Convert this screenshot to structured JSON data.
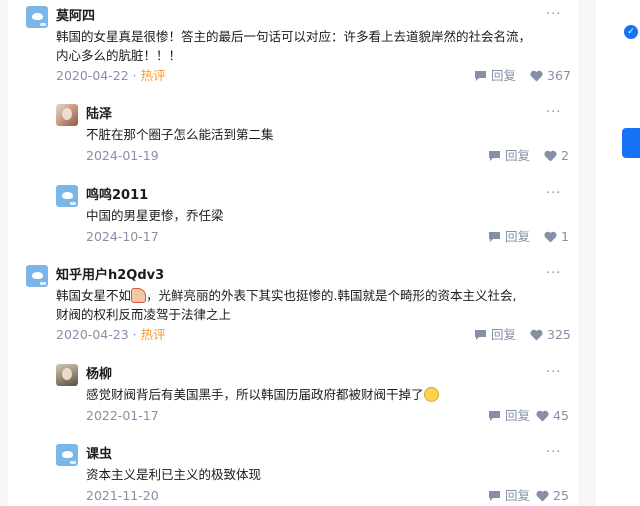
{
  "comments": [
    {
      "author": "莫阿四",
      "content_line1": "韩国的女星真是很惨！答主的最后一句话可以对应：许多看上去道貌岸然的社会名流，",
      "content_line2": "内心多么的肮脏！！！",
      "date": "2020-04-22",
      "separator": "·",
      "hot_label": "热评",
      "reply_label": "回复",
      "likes": "367"
    },
    {
      "author": "陆泽",
      "content": "不脏在那个圈子怎么能活到第二集",
      "date": "2024-01-19",
      "reply_label": "回复",
      "likes": "2"
    },
    {
      "author": "鸣鸣2011",
      "content": "中国的男星更惨，乔任梁",
      "date": "2024-10-17",
      "reply_label": "回复",
      "likes": "1"
    },
    {
      "author": "知乎用户h2Qdv3",
      "content_line1_a": "韩国女星不如",
      "content_line1_b": "，光鲜亮丽的外表下其实也挺惨的.韩国就是个畸形的资本主义社会,",
      "content_line2": "财阀的权利反而凌驾于法律之上",
      "date": "2020-04-23",
      "separator": "·",
      "hot_label": "热评",
      "reply_label": "回复",
      "likes": "325"
    },
    {
      "author": "杨柳",
      "content": "感觉财阀背后有美国黑手，所以韩国历届政府都被财阀干掉了",
      "date": "2022-01-17",
      "reply_label": "回复",
      "likes": "45"
    },
    {
      "author": "课虫",
      "content": "资本主义是利已主义的极致体现",
      "date": "2021-11-20",
      "reply_label": "回复",
      "likes": "25"
    }
  ],
  "more_glyph": "···",
  "icons": {
    "reply": "reply-icon",
    "like": "heart-icon",
    "more": "more-icon",
    "verified": "check-icon"
  },
  "colors": {
    "accent": "#1772f6",
    "meta": "#8590a6",
    "hot": "#ff961e"
  }
}
